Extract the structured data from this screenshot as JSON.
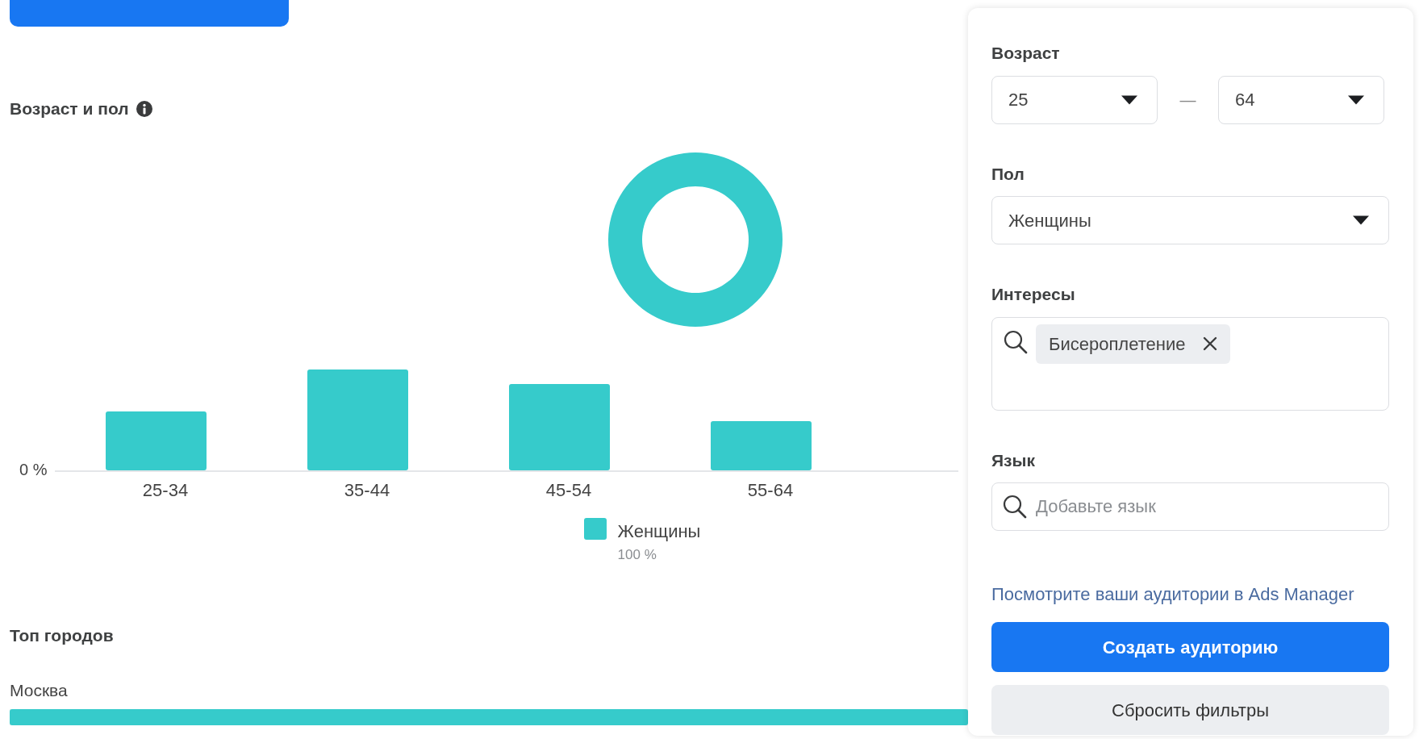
{
  "age_gender": {
    "title": "Возраст и пол",
    "axis_label": "0 %",
    "age_groups": [
      "25-34",
      "35-44",
      "45-54",
      "55-64"
    ],
    "legend": [
      {
        "label": "Женщины",
        "share": "100 %",
        "color": "#36cbcb"
      }
    ]
  },
  "top_cities": {
    "title": "Топ городов",
    "cities": [
      {
        "name": "Москва",
        "level": 1
      }
    ]
  },
  "filters": {
    "age": {
      "label": "Возраст",
      "from": "25",
      "separator": "—",
      "to": "64"
    },
    "gender": {
      "label": "Пол",
      "value": "Женщины"
    },
    "interests": {
      "label": "Интересы",
      "tags": [
        {
          "label": "Бисероплетение"
        }
      ]
    },
    "language": {
      "label": "Язык",
      "placeholder": "Добавьте язык"
    },
    "link": "Посмотрите ваши аудитории в Ads Manager",
    "buttons": [
      {
        "label": "Создать аудиторию",
        "kind": "primary"
      },
      {
        "label": "Сбросить фильтры",
        "kind": "secondary"
      }
    ]
  }
}
